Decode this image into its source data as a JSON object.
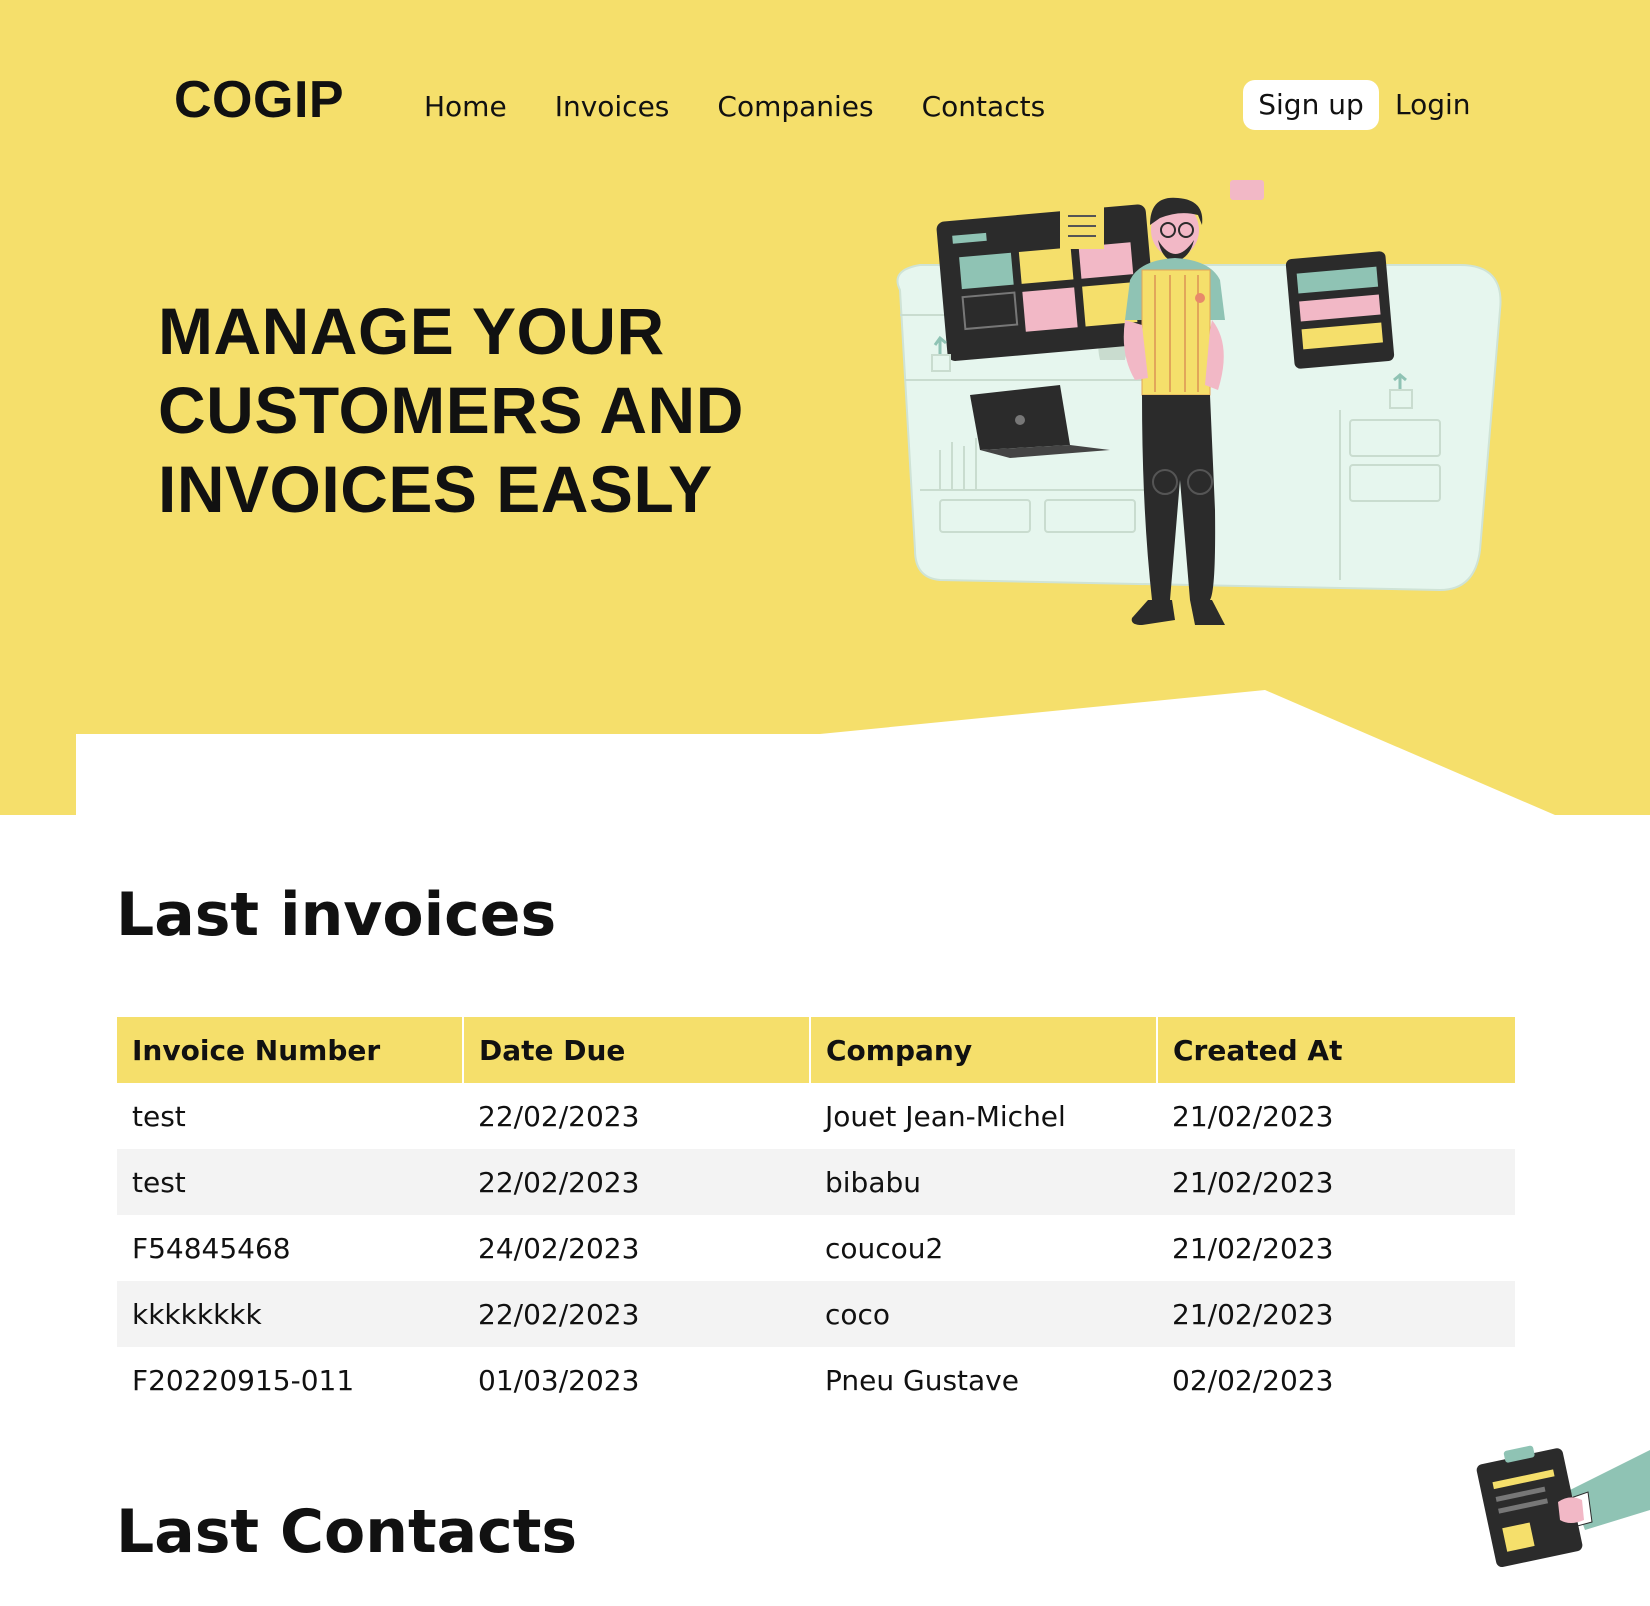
{
  "brand": {
    "logo": "COGIP"
  },
  "nav": {
    "items": [
      "Home",
      "Invoices",
      "Companies",
      "Contacts"
    ],
    "signup": "Sign up",
    "login": "Login"
  },
  "hero": {
    "headline_lines": [
      "MANAGE YOUR",
      "CUSTOMERS AND",
      "INVOICES EASLY"
    ]
  },
  "invoices": {
    "title": "Last invoices",
    "columns": [
      "Invoice Number",
      "Date Due",
      "Company",
      "Created At"
    ],
    "rows": [
      [
        "test",
        "22/02/2023",
        "Jouet Jean-Michel",
        "21/02/2023"
      ],
      [
        "test",
        "22/02/2023",
        "bibabu",
        "21/02/2023"
      ],
      [
        "F54845468",
        "24/02/2023",
        "coucou2",
        "21/02/2023"
      ],
      [
        "kkkkkkkk",
        "22/02/2023",
        "coco",
        "21/02/2023"
      ],
      [
        "F20220915-011",
        "01/03/2023",
        "Pneu Gustave",
        "02/02/2023"
      ]
    ]
  },
  "contacts": {
    "title": "Last Contacts"
  },
  "colors": {
    "accent": "#f5df6b",
    "text": "#111111",
    "row_alt": "#f3f3f3"
  },
  "icons": {
    "hero": "person-with-dashboards-illustration",
    "corner": "hand-holding-clipboard-illustration"
  }
}
